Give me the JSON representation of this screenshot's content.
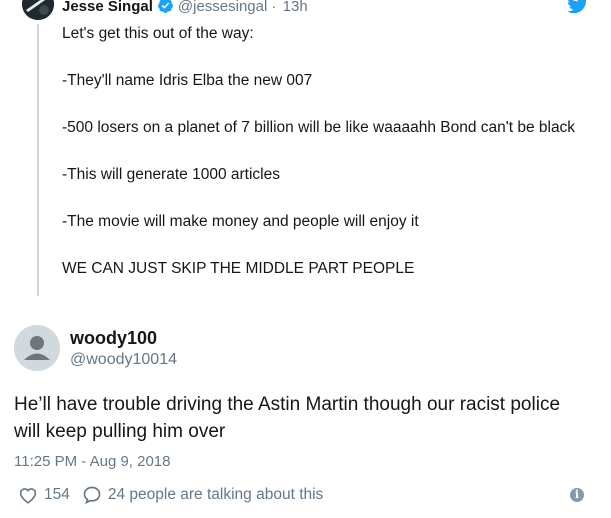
{
  "quoted": {
    "name": "Jesse Singal",
    "handle": "@jessesingal",
    "separator": "·",
    "time": "13h",
    "paragraphs": [
      "Let's get this out of the way:",
      "-They'll name Idris Elba the new 007",
      "-500 losers on a planet of 7 billion will be like waaaahh Bond can't be black",
      "-This will generate 1000 articles",
      "-The movie will make money and people will enjoy it",
      "WE CAN JUST SKIP THE MIDDLE PART PEOPLE"
    ]
  },
  "tweet": {
    "name": "woody100",
    "handle": "@woody10014",
    "text": "He’ll have trouble driving the Astin Martin though our racist police will keep pulling him over",
    "timestamp": "11:25 PM - Aug 9, 2018",
    "likes": "154",
    "conversation": "24 people are talking about this"
  },
  "colors": {
    "text": "#14171a",
    "secondary": "#657786",
    "twitter_blue": "#1da1f2",
    "thread_line": "#ccd6dd"
  },
  "icons": [
    "verified-badge-icon",
    "twitter-bird-icon",
    "heart-icon",
    "reply-bubble-icon",
    "info-icon",
    "default-avatar-icon"
  ]
}
